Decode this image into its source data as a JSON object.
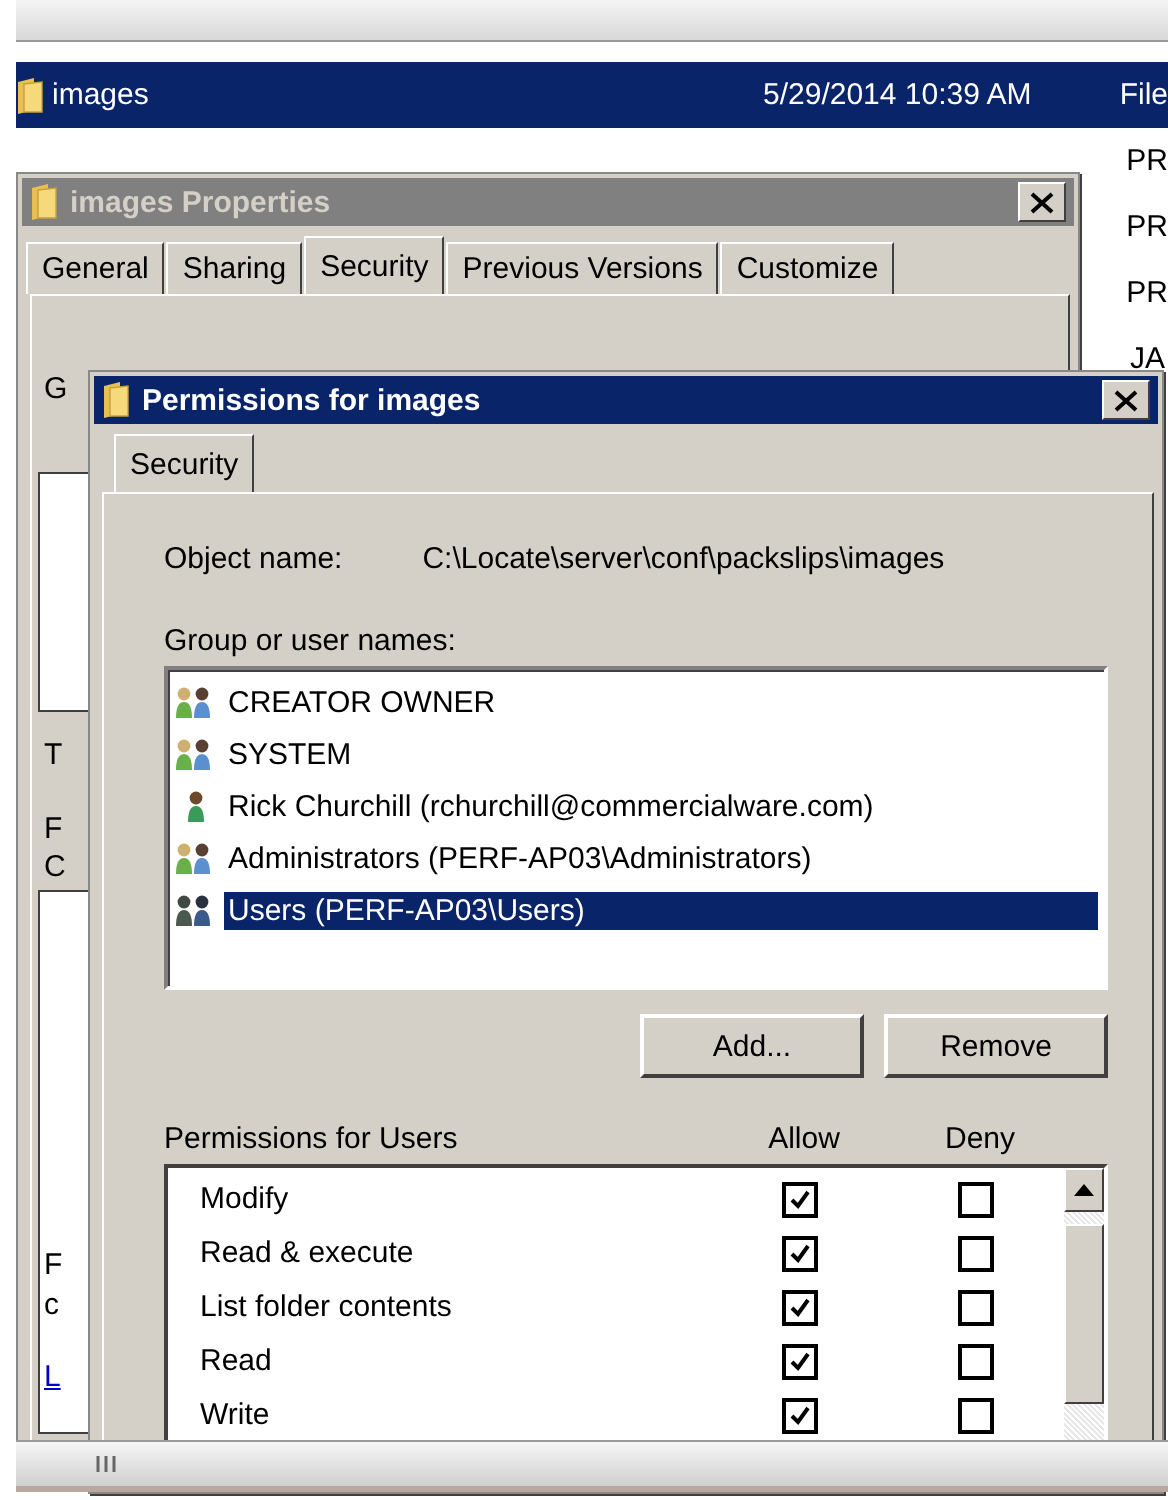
{
  "explorer": {
    "rows": [
      {
        "name": "images",
        "date": "5/29/2014 10:39 AM",
        "type": "File",
        "selected": true
      },
      {
        "type": "PR",
        "selected": false
      },
      {
        "type": "PR",
        "selected": false
      },
      {
        "type": "PR",
        "selected": false
      },
      {
        "type": "JA",
        "selected": false
      }
    ]
  },
  "properties": {
    "title": "images Properties",
    "active": false,
    "tabs": [
      {
        "label": "General",
        "selected": false
      },
      {
        "label": "Sharing",
        "selected": false
      },
      {
        "label": "Security",
        "selected": true
      },
      {
        "label": "Previous Versions",
        "selected": false
      },
      {
        "label": "Customize",
        "selected": false
      }
    ],
    "fragments": [
      {
        "text": "G",
        "kind": "label"
      },
      {
        "text": "T",
        "kind": "label"
      },
      {
        "text": "F",
        "kind": "label"
      },
      {
        "text": "C",
        "kind": "label"
      },
      {
        "text": "F",
        "kind": "label"
      },
      {
        "text": "c",
        "kind": "label"
      },
      {
        "text": "L",
        "kind": "link"
      }
    ]
  },
  "permissions": {
    "title": "Permissions for images",
    "active": true,
    "tab": "Security",
    "object_label": "Object name:",
    "object_value": "C:\\Locate\\server\\conf\\packslips\\images",
    "group_label": "Group or user names:",
    "principals": [
      {
        "name": "CREATOR OWNER",
        "kind": "group",
        "selected": false
      },
      {
        "name": "SYSTEM",
        "kind": "group",
        "selected": false
      },
      {
        "name": "Rick Churchill (rchurchill@commercialware.com)",
        "kind": "user",
        "selected": false
      },
      {
        "name": "Administrators (PERF-AP03\\Administrators)",
        "kind": "group",
        "selected": false
      },
      {
        "name": "Users (PERF-AP03\\Users)",
        "kind": "users",
        "selected": true
      }
    ],
    "buttons": [
      "Add...",
      "Remove"
    ],
    "perms_label": "Permissions for Users",
    "allow_header": "Allow",
    "deny_header": "Deny",
    "entries": [
      {
        "name": "Modify",
        "allow": true,
        "deny": false
      },
      {
        "name": "Read & execute",
        "allow": true,
        "deny": false
      },
      {
        "name": "List folder contents",
        "allow": true,
        "deny": false
      },
      {
        "name": "Read",
        "allow": true,
        "deny": false
      },
      {
        "name": "Write",
        "allow": true,
        "deny": false
      }
    ]
  }
}
